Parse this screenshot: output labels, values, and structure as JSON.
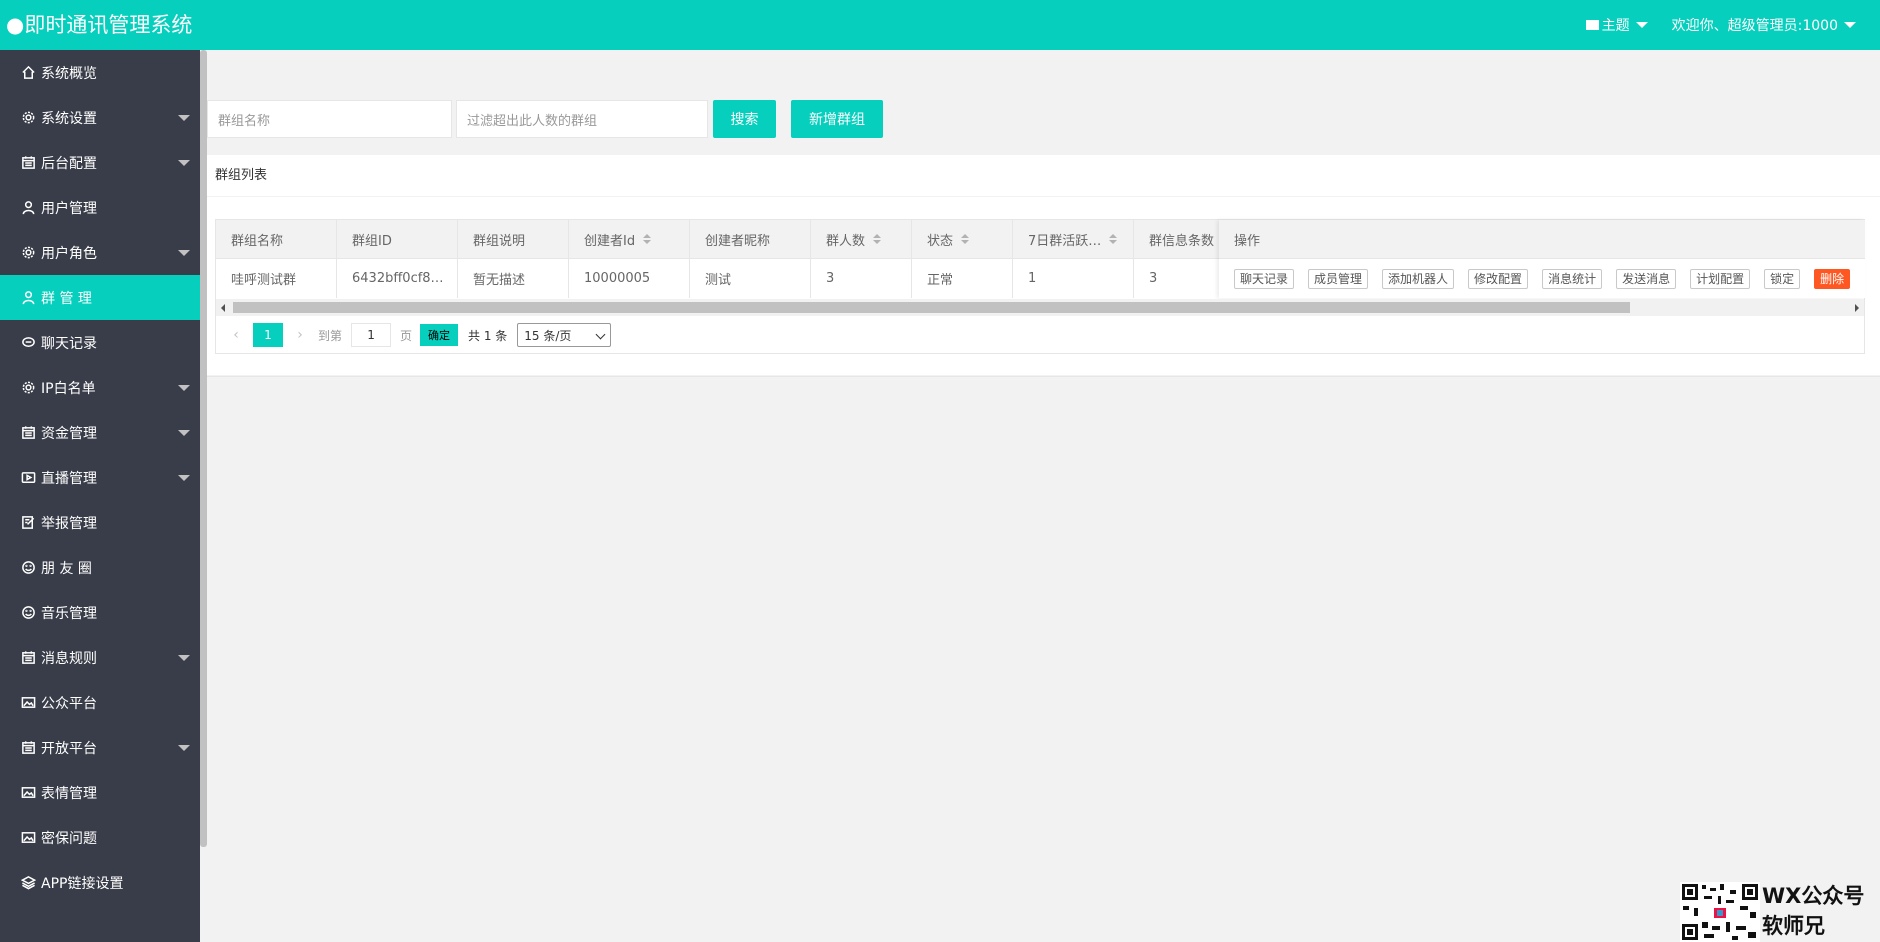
{
  "header": {
    "logo": "●即时通讯管理系统",
    "theme_label": "主题",
    "welcome": "欢迎你、超级管理员:1000"
  },
  "sidebar": {
    "items": [
      {
        "label": "系统概览",
        "icon": "home-icon",
        "has_arrow": false,
        "active": false
      },
      {
        "label": "系统设置",
        "icon": "gear-icon",
        "has_arrow": true,
        "active": false
      },
      {
        "label": "后台配置",
        "icon": "calendar-icon",
        "has_arrow": true,
        "active": false
      },
      {
        "label": "用户管理",
        "icon": "user-icon",
        "has_arrow": false,
        "active": false
      },
      {
        "label": "用户角色",
        "icon": "gear-icon",
        "has_arrow": true,
        "active": false
      },
      {
        "label": "群 管 理",
        "icon": "user-icon",
        "has_arrow": false,
        "active": true
      },
      {
        "label": "聊天记录",
        "icon": "chat-icon",
        "has_arrow": false,
        "active": false
      },
      {
        "label": "IP白名单",
        "icon": "gear-icon",
        "has_arrow": true,
        "active": false
      },
      {
        "label": "资金管理",
        "icon": "calendar-icon",
        "has_arrow": true,
        "active": false
      },
      {
        "label": "直播管理",
        "icon": "video-icon",
        "has_arrow": true,
        "active": false
      },
      {
        "label": "举报管理",
        "icon": "edit-icon",
        "has_arrow": false,
        "active": false
      },
      {
        "label": "朋 友 圈",
        "icon": "smile-icon",
        "has_arrow": false,
        "active": false
      },
      {
        "label": "音乐管理",
        "icon": "smile-icon",
        "has_arrow": false,
        "active": false
      },
      {
        "label": "消息规则",
        "icon": "calendar-icon",
        "has_arrow": true,
        "active": false
      },
      {
        "label": "公众平台",
        "icon": "picture-icon",
        "has_arrow": false,
        "active": false
      },
      {
        "label": "开放平台",
        "icon": "calendar-icon",
        "has_arrow": true,
        "active": false
      },
      {
        "label": "表情管理",
        "icon": "picture-icon",
        "has_arrow": false,
        "active": false
      },
      {
        "label": "密保问题",
        "icon": "picture-icon",
        "has_arrow": false,
        "active": false
      },
      {
        "label": "APP链接设置",
        "icon": "layers-icon",
        "has_arrow": false,
        "active": false
      }
    ]
  },
  "search": {
    "group_name_placeholder": "群组名称",
    "filter_placeholder": "过滤超出此人数的群组",
    "search_label": "搜索",
    "add_label": "新增群组"
  },
  "card": {
    "title": "群组列表"
  },
  "table": {
    "columns": [
      {
        "label": "群组名称",
        "sortable": false
      },
      {
        "label": "群组ID",
        "sortable": false
      },
      {
        "label": "群组说明",
        "sortable": false
      },
      {
        "label": "创建者Id",
        "sortable": true
      },
      {
        "label": "创建者昵称",
        "sortable": false
      },
      {
        "label": "群人数",
        "sortable": true
      },
      {
        "label": "状态",
        "sortable": true
      },
      {
        "label": "7日群活跃…",
        "sortable": true
      },
      {
        "label": "群信息条数",
        "sortable": false
      }
    ],
    "rows": [
      [
        "哇呼测试群",
        "6432bff0cf8…",
        "暂无描述",
        "10000005",
        "测试",
        "3",
        "正常",
        "1",
        "3"
      ]
    ],
    "ops_header": "操作",
    "ops": [
      "聊天记录",
      "成员管理",
      "添加机器人",
      "修改配置",
      "消息统计",
      "发送消息",
      "计划配置",
      "锁定",
      "删除"
    ]
  },
  "pager": {
    "current_page": "1",
    "goto_label": "到第",
    "goto_value": "1",
    "page_unit": "页",
    "confirm_label": "确定",
    "total": "共 1 条",
    "page_size": "15 条/页"
  },
  "watermark": {
    "line1": "WX公众号",
    "line2": "软师兄"
  }
}
